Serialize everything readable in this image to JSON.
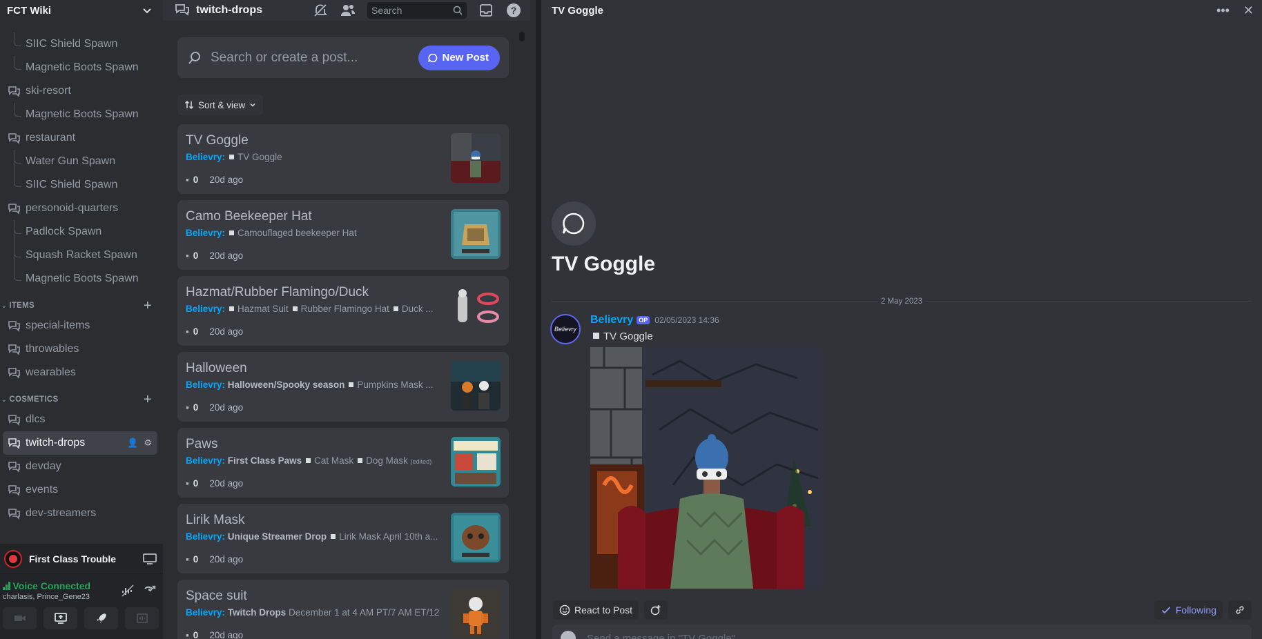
{
  "sidebar": {
    "server_name": "FCT Wiki",
    "channels_top": [
      {
        "type": "thread",
        "label": "SIIC Shield Spawn"
      },
      {
        "type": "thread",
        "label": "Magnetic Boots Spawn"
      },
      {
        "type": "channel",
        "label": "ski-resort"
      },
      {
        "type": "thread",
        "label": "Magnetic Boots Spawn"
      },
      {
        "type": "channel",
        "label": "restaurant"
      },
      {
        "type": "thread",
        "label": "Water Gun Spawn"
      },
      {
        "type": "thread",
        "label": "SIIC Shield Spawn"
      },
      {
        "type": "channel",
        "label": "personoid-quarters"
      },
      {
        "type": "thread",
        "label": "Padlock Spawn"
      },
      {
        "type": "thread",
        "label": "Squash Racket Spawn"
      },
      {
        "type": "thread",
        "label": "Magnetic Boots Spawn"
      }
    ],
    "category_items": "ITEMS",
    "items_channels": [
      "special-items",
      "throwables",
      "wearables"
    ],
    "category_cosmetics": "COSMETICS",
    "cosmetics_channels": [
      "dlcs",
      "twitch-drops",
      "devday",
      "events",
      "dev-streamers"
    ],
    "active_channel": "twitch-drops"
  },
  "user_panel": {
    "activity_name": "First Class Trouble",
    "voice_status": "Voice Connected",
    "voice_members": "charlasis, Prince_Gene23"
  },
  "forum": {
    "channel_title": "twitch-drops",
    "search_placeholder": "Search",
    "search_create_placeholder": "Search or create a post...",
    "new_post_label": "New Post",
    "sort_label": "Sort & view",
    "posts": [
      {
        "title": "TV Goggle",
        "author": "Believry",
        "lead": "",
        "tags": [
          "TV Goggle"
        ],
        "comments": "0",
        "age": "20d ago"
      },
      {
        "title": "Camo Beekeeper Hat",
        "author": "Believry",
        "lead": "",
        "tags": [
          "Camouflaged beekeeper Hat"
        ],
        "comments": "0",
        "age": "20d ago"
      },
      {
        "title": "Hazmat/Rubber Flamingo/Duck",
        "author": "Believry",
        "lead": "",
        "tags": [
          "Hazmat Suit",
          "Rubber Flamingo Hat",
          "Duck ..."
        ],
        "comments": "0",
        "age": "20d ago"
      },
      {
        "title": "Halloween",
        "author": "Believry",
        "lead": "Halloween/Spooky season",
        "tags": [
          "Pumpkins Mask ..."
        ],
        "comments": "0",
        "age": "20d ago"
      },
      {
        "title": "Paws",
        "author": "Believry",
        "lead": "First Class Paws",
        "tags": [
          "Cat Mask",
          "Dog Mask"
        ],
        "edited": "(edited)",
        "comments": "0",
        "age": "20d ago"
      },
      {
        "title": "Lirik Mask",
        "author": "Believry",
        "lead": "Unique Streamer Drop",
        "tags": [
          "Lirik Mask April 10th a..."
        ],
        "comments": "0",
        "age": "20d ago"
      },
      {
        "title": "Space suit",
        "author": "Believry",
        "lead": "Twitch Drops",
        "tail": "December 1 at 4 AM PT/7 AM ET/12 ...",
        "tags": [],
        "comments": "0",
        "age": "20d ago"
      }
    ]
  },
  "thread": {
    "title": "TV Goggle",
    "big_title": "TV Goggle",
    "date_divider": "2 May 2023",
    "message": {
      "author": "Believry",
      "badge": "OP",
      "timestamp": "02/05/2023 14:36",
      "tag": "TV Goggle",
      "avatar_text": "Believry"
    },
    "react_label": "React to Post",
    "following_label": "Following",
    "composer_placeholder": "Send a message in \"TV Goggle\""
  },
  "colors": {
    "accent": "#5865f2",
    "author_blue": "#00a8fc",
    "voice_green": "#23a55a"
  }
}
